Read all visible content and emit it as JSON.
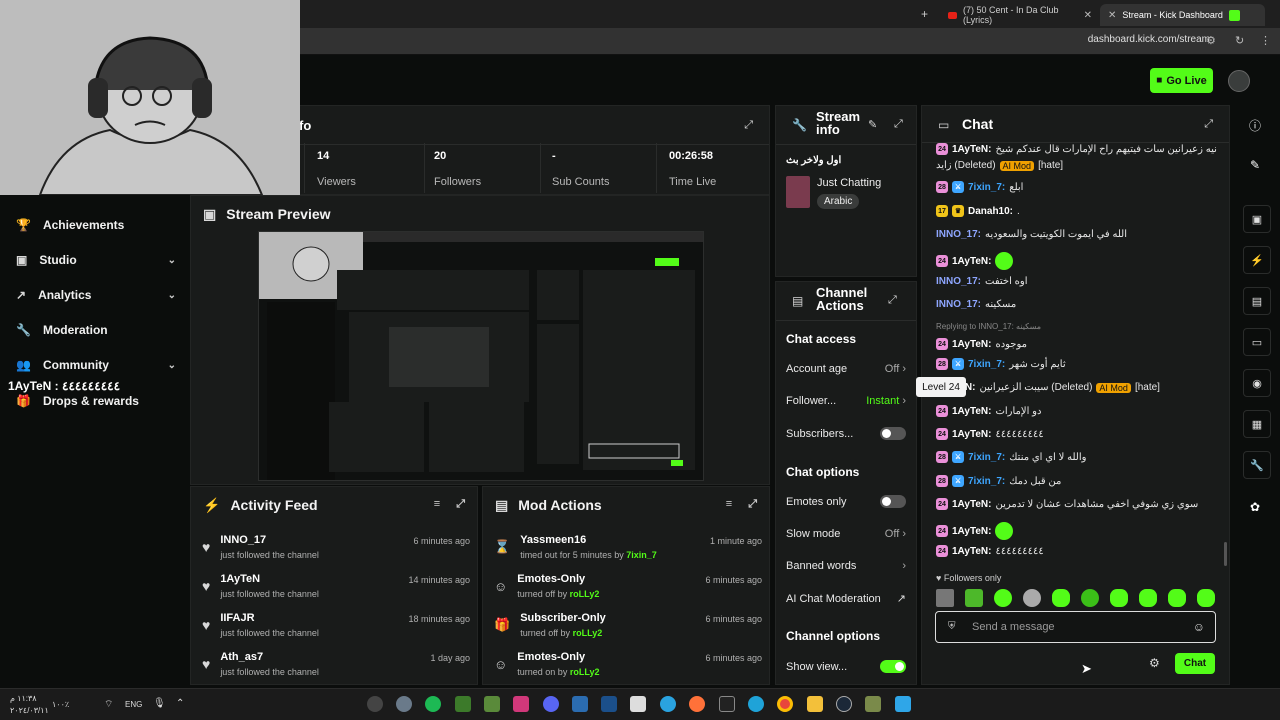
{
  "browser": {
    "tabs": [
      {
        "label": "(7) 50 Cent - In Da Club (Lyrics)"
      },
      {
        "label": "Stream - Kick Dashboard"
      }
    ],
    "url": "dashboard.kick.com/stream"
  },
  "header": {
    "go_live": "Go Live"
  },
  "overlay": {
    "name_text": "1AyTeN : ٤٤٤٤٤٤٤٤٤"
  },
  "sidebar": {
    "items": [
      {
        "label": "Achievements"
      },
      {
        "label": "Studio"
      },
      {
        "label": "Analytics"
      },
      {
        "label": "Moderation"
      },
      {
        "label": "Community"
      },
      {
        "label": "Drops & rewards"
      }
    ]
  },
  "stream_info": {
    "title_fragment": "fo",
    "stats": [
      {
        "value": "14",
        "label": "Viewers"
      },
      {
        "value": "20",
        "label": "Followers"
      },
      {
        "value": "-",
        "label": "Sub Counts"
      },
      {
        "value": "00:26:58",
        "label": "Time Live"
      }
    ]
  },
  "preview": {
    "title": "Stream Preview"
  },
  "stream_info_card": {
    "title": "Stream info",
    "stream_title": "اول ولاخر بث",
    "category": "Just Chatting",
    "language": "Arabic"
  },
  "channel_actions": {
    "title": "Channel Actions",
    "chat_access": "Chat access",
    "account_age": {
      "label": "Account age",
      "value": "Off"
    },
    "follower": {
      "label": "Follower...",
      "value": "Instant"
    },
    "subscribers": {
      "label": "Subscribers..."
    },
    "chat_options": "Chat options",
    "emotes_only": {
      "label": "Emotes only"
    },
    "slow_mode": {
      "label": "Slow mode",
      "value": "Off"
    },
    "banned_words": {
      "label": "Banned words"
    },
    "ai_moderation": {
      "label": "AI Chat Moderation"
    },
    "channel_options": "Channel options",
    "show_view": {
      "label": "Show view..."
    }
  },
  "activity": {
    "title": "Activity Feed",
    "items": [
      {
        "name": "INNO_17",
        "action": "just followed the channel",
        "time": "6 minutes ago"
      },
      {
        "name": "1AyTeN",
        "action": "just followed the channel",
        "time": "14 minutes ago"
      },
      {
        "name": "IIFAJR",
        "action": "just followed the channel",
        "time": "18 minutes ago"
      },
      {
        "name": "Ath_as7",
        "action": "just followed the channel",
        "time": "1 day ago"
      }
    ]
  },
  "mod_actions": {
    "title": "Mod Actions",
    "items": [
      {
        "name": "Yassmeen16",
        "action": "timed out for 5 minutes by",
        "by": "7ixin_7",
        "time": "1 minute ago"
      },
      {
        "name": "Emotes-Only",
        "action": "turned off by",
        "by": "roLLy2",
        "time": "6 minutes ago"
      },
      {
        "name": "Subscriber-Only",
        "action": "turned off by",
        "by": "roLLy2",
        "time": "6 minutes ago"
      },
      {
        "name": "Emotes-Only",
        "action": "turned on by",
        "by": "roLLy2",
        "time": "6 minutes ago"
      }
    ]
  },
  "chat": {
    "title": "Chat",
    "messages": [
      {
        "badge": "24",
        "user": "1AyTeN:",
        "text": "نيه زعيرانين سات فيتيهم راح الإمارات قال عندكم شيخ",
        "color": "#ffffff"
      },
      {
        "badge": "",
        "user": "",
        "text": "زايد (Deleted)",
        "tag": "AI Mod",
        "extra": "[hate]",
        "color": "#ffffff"
      },
      {
        "badge": "28",
        "user": "7ixin_7:",
        "text": "ابلع",
        "color": "#3ea6ff"
      },
      {
        "badge": "17",
        "user": "Danah10:",
        "text": ".",
        "color": "#ffffff"
      },
      {
        "badge": "",
        "user": "INNO_17:",
        "text": "الله في ايموت الكويتيت والسعوديه",
        "color": "#8ea6ff"
      },
      {
        "badge": "24",
        "user": "1AyTeN:",
        "text": "",
        "color": "#ffffff"
      },
      {
        "badge": "",
        "user": "INNO_17:",
        "text": "اوه اختفت",
        "color": "#8ea6ff"
      },
      {
        "badge": "",
        "user": "INNO_17:",
        "text": "مسكينه",
        "color": "#8ea6ff"
      },
      {
        "badge": "",
        "user": "",
        "text": "Replying to INNO_17: مسكينه",
        "color": "#888888"
      },
      {
        "badge": "24",
        "user": "1AyTeN:",
        "text": "موجوده",
        "color": "#ffffff"
      },
      {
        "badge": "28",
        "user": "7ixin_7:",
        "text": "ثايم أوت شهر",
        "color": "#3ea6ff"
      },
      {
        "badge": "",
        "user": "1AyTeN:",
        "text": "سيبت الزعيرانين (Deleted)",
        "tag": "AI Mod",
        "extra": "[hate]",
        "color": "#ffffff"
      },
      {
        "badge": "24",
        "user": "1AyTeN:",
        "text": "دو الإمارات",
        "color": "#ffffff"
      },
      {
        "badge": "24",
        "user": "1AyTeN:",
        "text": "٤٤٤٤٤٤٤٤٤",
        "color": "#ffffff"
      },
      {
        "badge": "28",
        "user": "7ixin_7:",
        "text": "والله لا اي اي منتك",
        "color": "#3ea6ff"
      },
      {
        "badge": "28",
        "user": "7ixin_7:",
        "text": "من قبل دمك",
        "color": "#3ea6ff"
      },
      {
        "badge": "24",
        "user": "1AyTeN:",
        "text": "سوي زي شوفي اخفي مشاهدات عشان لا تدمرين",
        "color": "#ffffff"
      },
      {
        "badge": "24",
        "user": "1AyTeN:",
        "text": "",
        "color": "#ffffff"
      },
      {
        "badge": "24",
        "user": "1AyTeN:",
        "text": "٤٤٤٤٤٤٤٤٤",
        "color": "#ffffff"
      }
    ],
    "followers_only": "Followers only",
    "placeholder": "Send a message",
    "send_label": "Chat",
    "tooltip": "Level 24"
  },
  "taskbar": {
    "tray": {
      "lang": "ENG",
      "battery": "١٠٠٪",
      "time": "١١:٣٨ م",
      "date": "٢٠٢٤/٠٣/١١"
    }
  },
  "colors": {
    "accent": "#53fc18",
    "panel": "#191b1a",
    "bg": "#0b0d0c"
  }
}
